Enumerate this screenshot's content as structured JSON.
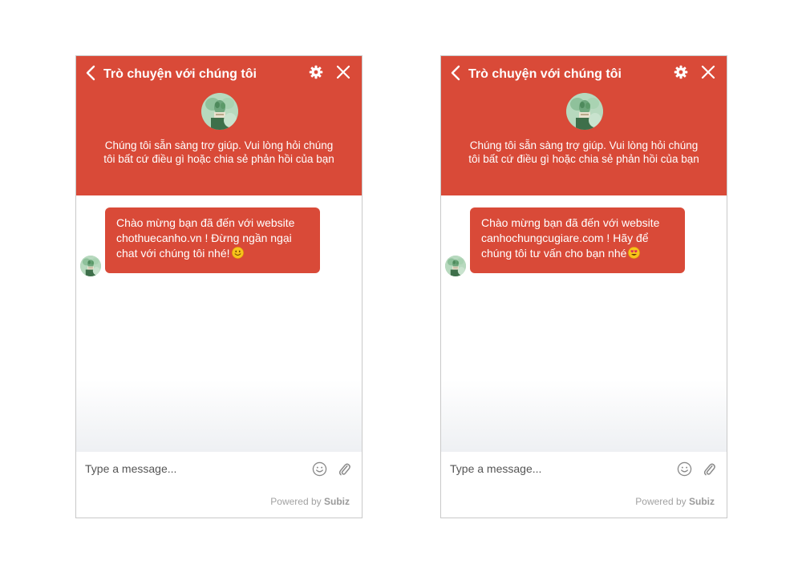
{
  "widgets": [
    {
      "header": {
        "title": "Trò chuyện với chúng tôi",
        "tagline_line1": "Chúng tôi sẵn sàng trợ giúp. Vui lòng hỏi chúng",
        "tagline_line2": "tôi bất cứ điều gì hoặc chia sẻ phản hồi của bạn"
      },
      "message": {
        "line1": "Chào mừng bạn đã đến với website",
        "line2": "chothuecanho.vn ! Đừng ngần ngại",
        "line3": "chat với chúng tôi nhé!",
        "emoji": "smiling-face"
      },
      "composer": {
        "placeholder": "Type a message..."
      },
      "footer": {
        "powered_prefix": "Powered by",
        "brand": "Subiz"
      }
    },
    {
      "header": {
        "title": "Trò chuyện với chúng tôi",
        "tagline_line1": "Chúng tôi sẵn sàng trợ giúp. Vui lòng hỏi chúng",
        "tagline_line2": "tôi bất cứ điều gì hoặc chia sẻ phản hồi của bạn"
      },
      "message": {
        "line1": "Chào mừng bạn đã đến với website",
        "line2": "canhochungcugiare.com ! Hãy để",
        "line3": "chúng tôi tư vấn cho bạn nhé",
        "emoji": "heart-eyes-face"
      },
      "composer": {
        "placeholder": "Type a message..."
      },
      "footer": {
        "powered_prefix": "Powered by",
        "brand": "Subiz"
      }
    }
  ],
  "colors": {
    "accent": "#d94a38",
    "text_on_accent": "#ffffff",
    "muted": "#a2a2a2"
  }
}
